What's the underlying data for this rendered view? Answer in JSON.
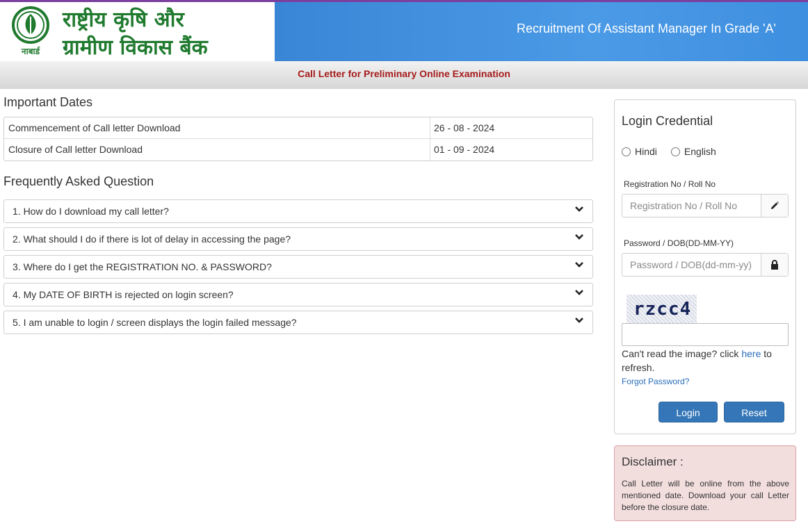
{
  "header": {
    "org_name_line1": "राष्ट्रीय कृषि और",
    "org_name_line2": "ग्रामीण विकास बैंक",
    "logo_text": "नाबार्ड",
    "banner_title": "Recruitment Of Assistant Manager In Grade 'A'",
    "accent_color": "#3a86d6"
  },
  "subbar": {
    "title": "Call Letter for Preliminary Online Examination"
  },
  "important_dates": {
    "title": "Important Dates",
    "rows": [
      {
        "label": "Commencement of Call letter Download",
        "value": "26 - 08 - 2024"
      },
      {
        "label": "Closure of Call letter Download",
        "value": "01 - 09 - 2024"
      }
    ]
  },
  "faq": {
    "title": "Frequently Asked Question",
    "items": [
      "1. How do I download my call letter?",
      "2. What should I do if there is lot of delay in accessing the page?",
      "3. Where do I get the REGISTRATION NO. & PASSWORD?",
      "4. My DATE OF BIRTH is rejected on login screen?",
      "5. I am unable to login / screen displays the login failed message?"
    ]
  },
  "login": {
    "title": "Login Credential",
    "lang_hindi": "Hindi",
    "lang_english": "English",
    "reg_label": "Registration No / Roll No",
    "reg_placeholder": "Registration No / Roll No",
    "pwd_label": "Password / DOB(DD-MM-YY)",
    "pwd_placeholder": "Password / DOB(dd-mm-yy)",
    "captcha_text": "rzcc4",
    "captcha_note_before": "Can't read the image? click ",
    "captcha_link": "here",
    "captcha_note_after": " to refresh.",
    "forgot": "Forgot Password?",
    "login_button": "Login",
    "reset_button": "Reset"
  },
  "disclaimer": {
    "title": "Disclaimer :",
    "text": "Call Letter will be online from the above mentioned date. Download your call Letter before the closure date."
  }
}
